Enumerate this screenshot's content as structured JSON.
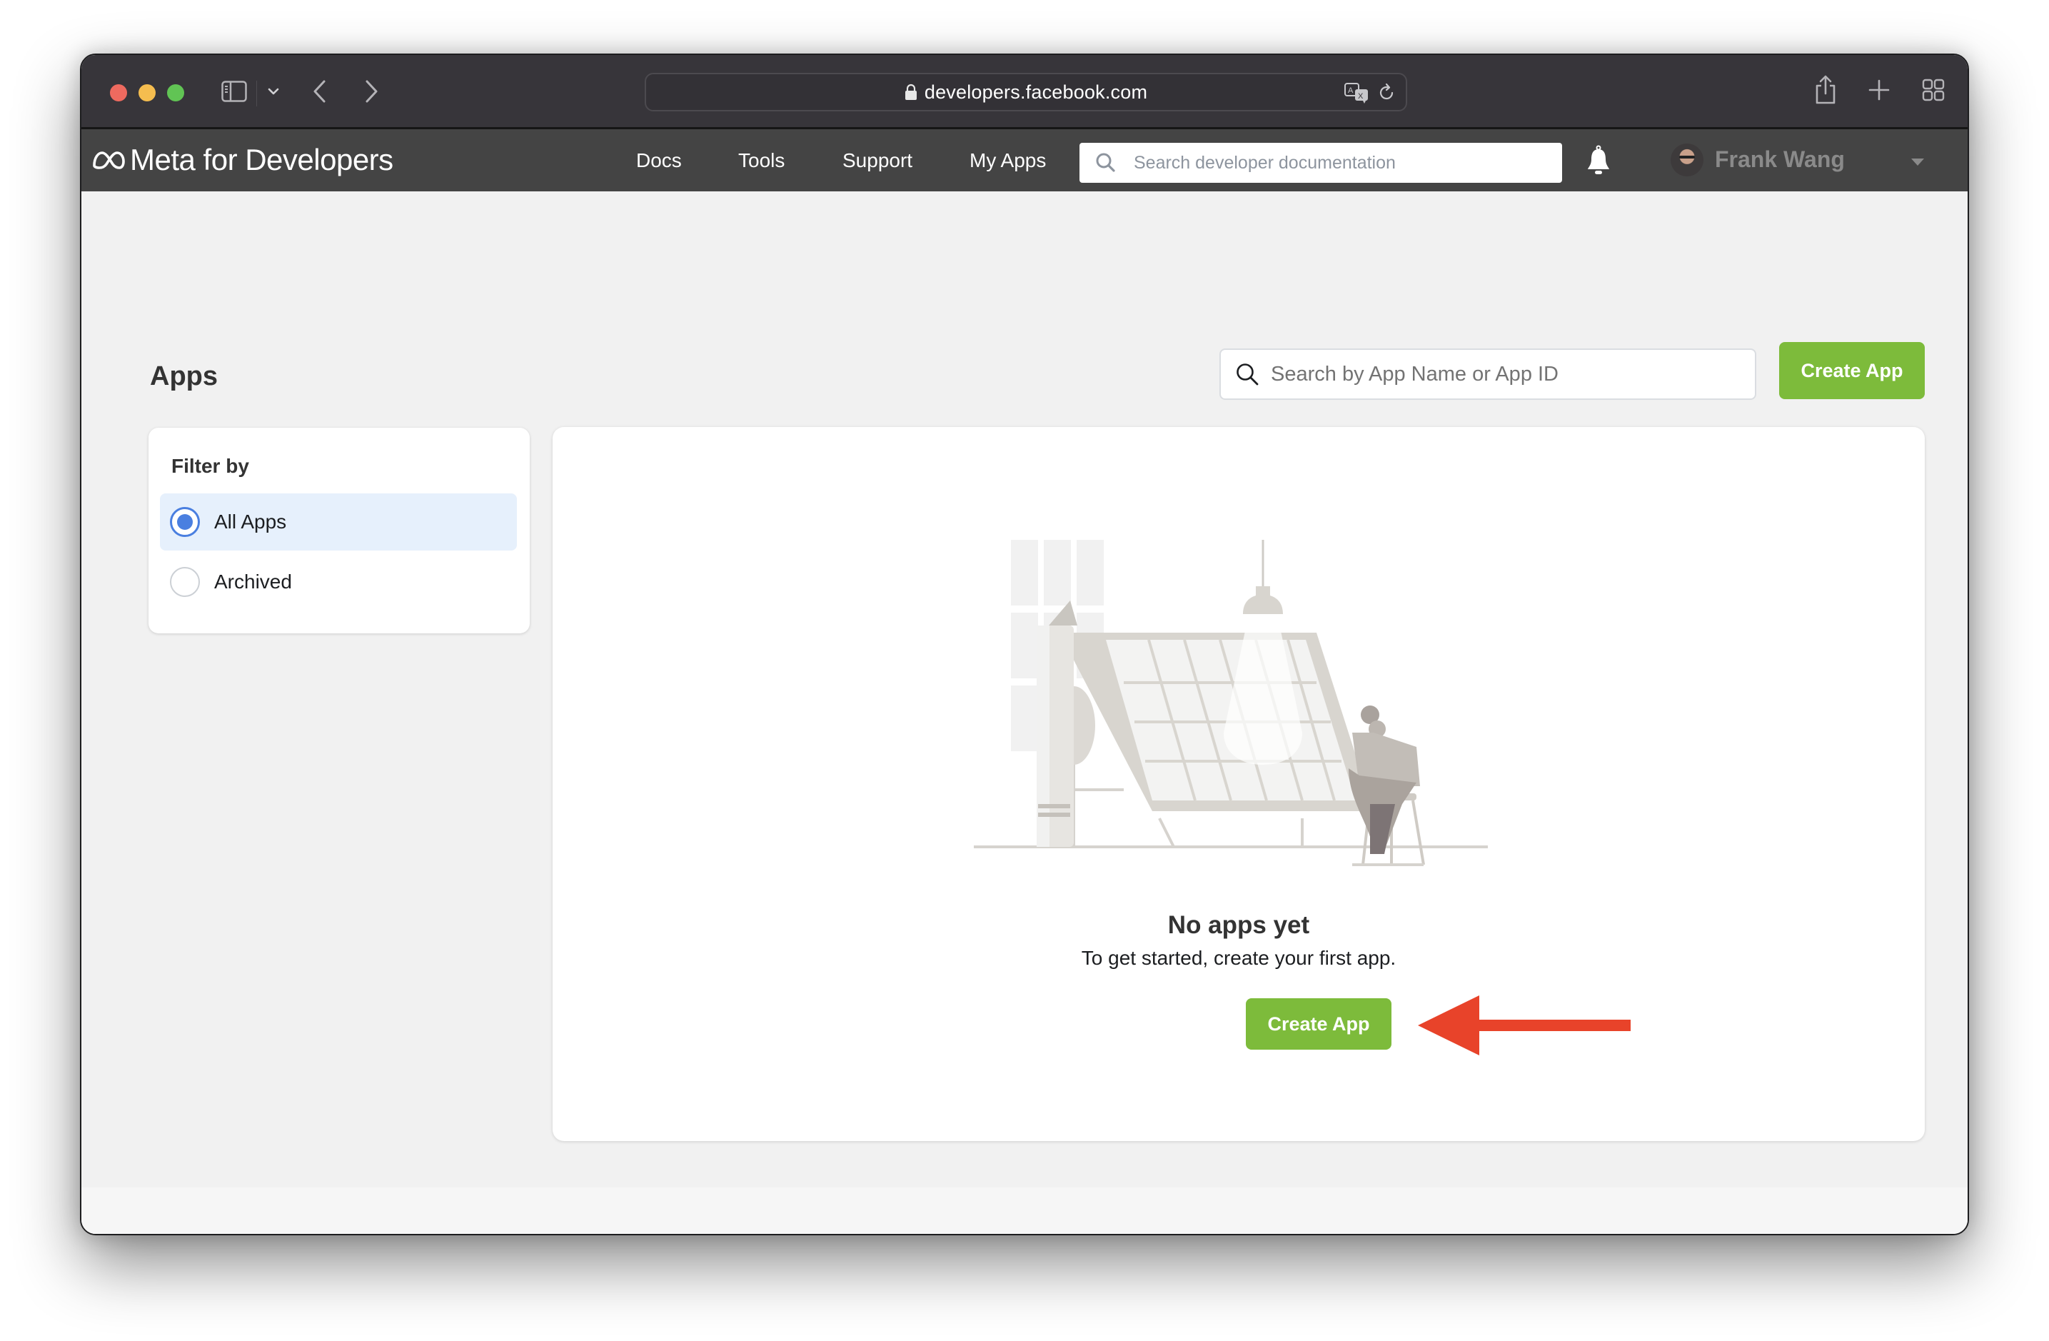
{
  "browser": {
    "address": "developers.facebook.com",
    "icons": [
      "sidebar-toggle-icon",
      "chevron-down-icon",
      "back-icon",
      "forward-icon",
      "lock-icon",
      "translate-icon",
      "reload-icon",
      "share-icon",
      "new-tab-icon",
      "tab-overview-icon"
    ]
  },
  "site_nav": {
    "brand": "Meta for Developers",
    "links": [
      "Docs",
      "Tools",
      "Support",
      "My Apps"
    ],
    "search_placeholder": "Search developer documentation",
    "user_name": "Frank Wang"
  },
  "page": {
    "title": "Apps",
    "app_search_placeholder": "Search by App Name or App ID",
    "create_app_label": "Create App",
    "filter": {
      "title": "Filter by",
      "options": [
        {
          "label": "All Apps",
          "selected": true
        },
        {
          "label": "Archived",
          "selected": false
        }
      ]
    },
    "empty_state": {
      "title": "No apps yet",
      "subtitle": "To get started, create your first app.",
      "button_label": "Create App"
    }
  },
  "colors": {
    "accent_green": "#7dbb3b",
    "radio_blue": "#4a7fe0",
    "selected_bg": "#e6f0fc",
    "annotation_red": "#e8432a",
    "nav_bg": "#444444",
    "titlebar_bg": "#37353a"
  }
}
